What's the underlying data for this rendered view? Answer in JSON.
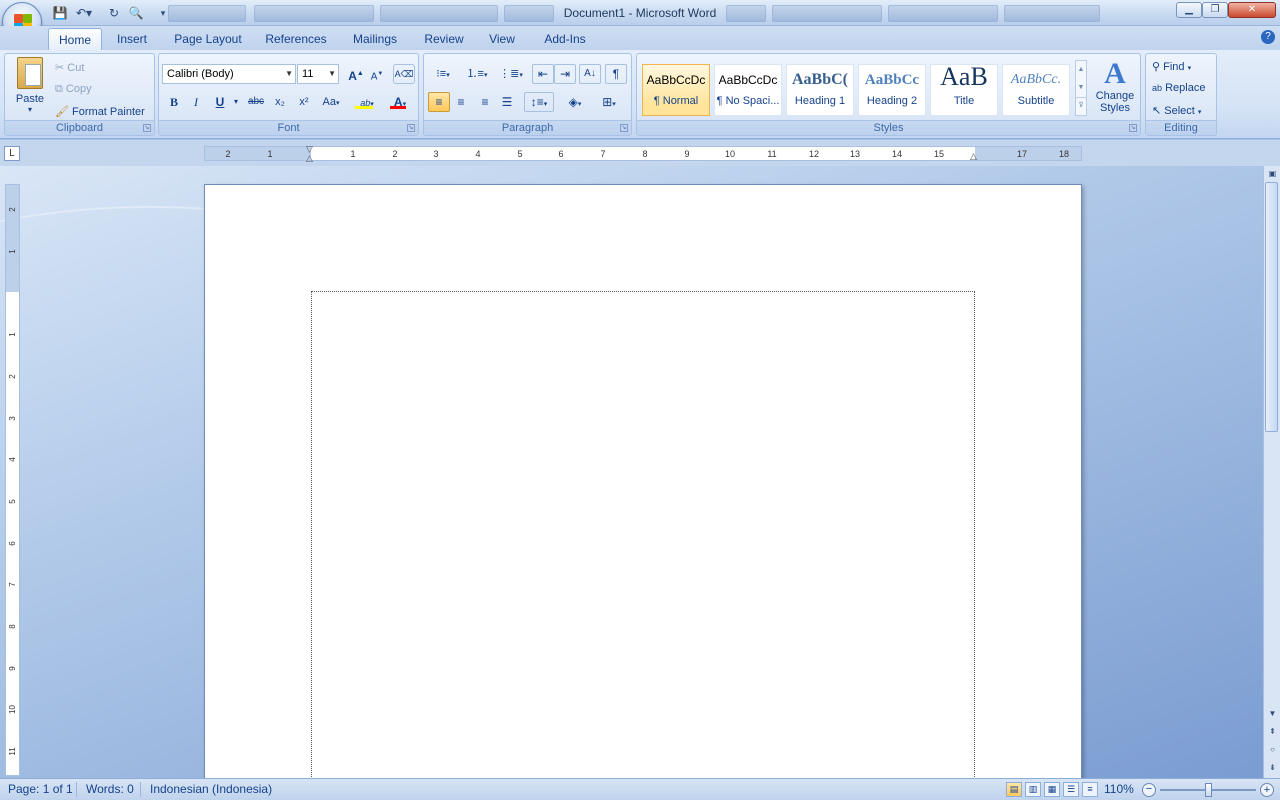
{
  "title": "Document1 - Microsoft Word",
  "tabs": [
    "Home",
    "Insert",
    "Page Layout",
    "References",
    "Mailings",
    "Review",
    "View",
    "Add-Ins"
  ],
  "clipboard": {
    "paste": "Paste",
    "cut": "Cut",
    "copy": "Copy",
    "format_painter": "Format Painter",
    "label": "Clipboard"
  },
  "font": {
    "name": "Calibri (Body)",
    "size": "11",
    "label": "Font",
    "bold": "B",
    "italic": "I",
    "underline": "U",
    "strike": "abc",
    "sub": "x₂",
    "sup": "x²",
    "case": "Aa",
    "grow": "A",
    "shrink": "A"
  },
  "paragraph": {
    "label": "Paragraph"
  },
  "styles": {
    "label": "Styles",
    "items": [
      {
        "sample": "AaBbCcDc",
        "name": "¶ Normal"
      },
      {
        "sample": "AaBbCcDc",
        "name": "¶ No Spaci..."
      },
      {
        "sample": "AaBbC(",
        "name": "Heading 1"
      },
      {
        "sample": "AaBbCc",
        "name": "Heading 2"
      },
      {
        "sample": "AaB",
        "name": "Title"
      },
      {
        "sample": "AaBbCc.",
        "name": "Subtitle"
      }
    ],
    "change": "Change Styles"
  },
  "editing": {
    "find": "Find",
    "replace": "Replace",
    "select": "Select",
    "label": "Editing"
  },
  "ruler": {
    "h_left": [
      "2",
      "1"
    ],
    "h_main": [
      "1",
      "2",
      "3",
      "4",
      "5",
      "6",
      "7",
      "8",
      "9",
      "10",
      "11",
      "12",
      "13",
      "14",
      "15"
    ],
    "h_right": [
      "17",
      "18"
    ],
    "v_top": [
      "2",
      "1"
    ],
    "v_main": [
      "1",
      "2",
      "3",
      "4",
      "5",
      "6",
      "7",
      "8",
      "9",
      "10",
      "11"
    ]
  },
  "status": {
    "page": "Page: 1 of 1",
    "words": "Words: 0",
    "language": "Indonesian (Indonesia)",
    "zoom": "110%"
  },
  "colors": {
    "highlight": "#ffff00",
    "font_color": "#ff0000"
  }
}
